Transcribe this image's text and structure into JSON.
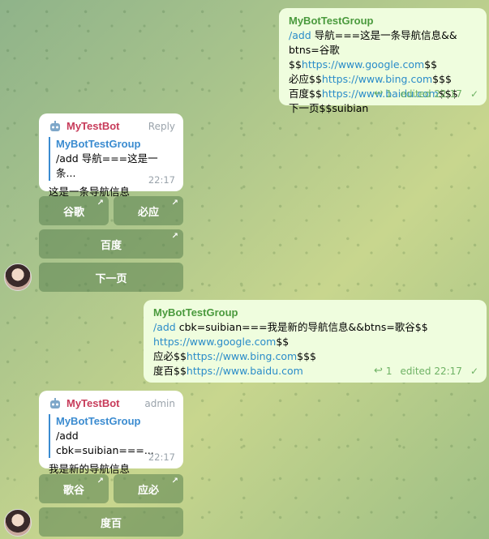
{
  "msg1": {
    "sender": "MyBotTestGroup",
    "lines": [
      [
        {
          "t": "/add",
          "c": "cmd"
        },
        {
          "t": " 导航===这是一条导航信息&&"
        }
      ],
      [
        {
          "t": "btns=谷歌$$"
        },
        {
          "t": "https://www.google.com",
          "c": "link"
        },
        {
          "t": "$$"
        }
      ],
      [
        {
          "t": "必应$$"
        },
        {
          "t": "https://www.bing.com",
          "c": "link"
        },
        {
          "t": "$$$"
        }
      ],
      [
        {
          "t": "百度$$"
        },
        {
          "t": "https://www.baidu.com",
          "c": "link"
        },
        {
          "t": "$$$"
        }
      ],
      [
        {
          "t": "下一页$$suibian"
        }
      ]
    ],
    "replies": "1",
    "edited": "edited 22:17"
  },
  "bot1": {
    "name": "MyTestBot",
    "right": "Reply",
    "quote_name": "MyBotTestGroup",
    "quote_text": "/add 导航===这是一条...",
    "text": "这是一条导航信息",
    "time": "22:17",
    "buttons": [
      "谷歌",
      "必应",
      "百度",
      "下一页"
    ]
  },
  "msg2": {
    "sender": "MyBotTestGroup",
    "lines": [
      [
        {
          "t": "/add",
          "c": "cmd"
        },
        {
          "t": " cbk=suibian===我是新的导航信息&&btns=歌谷$$"
        }
      ],
      [
        {
          "t": "https://www.google.com",
          "c": "link"
        },
        {
          "t": "$$"
        }
      ],
      [
        {
          "t": "应必$$"
        },
        {
          "t": "https://www.bing.com",
          "c": "link"
        },
        {
          "t": "$$$"
        }
      ],
      [
        {
          "t": "度百$$"
        },
        {
          "t": "https://www.baidu.com",
          "c": "link"
        }
      ]
    ],
    "replies": "1",
    "edited": "edited 22:17"
  },
  "bot2": {
    "name": "MyTestBot",
    "right": "admin",
    "quote_name": "MyBotTestGroup",
    "quote_text": "/add cbk=suibian===...",
    "text": "我是新的导航信息",
    "time": "22:17",
    "buttons": [
      "歌谷",
      "应必",
      "度百"
    ]
  },
  "icons": {
    "reply": "reply-arrow-icon",
    "check": "check-icon",
    "link_arrow": "external-link-arrow-icon",
    "bot": "robot-icon"
  },
  "colors": {
    "out_bubble": "#effdde",
    "in_bubble": "#ffffff",
    "sender": "#4a9a3d",
    "bot_name": "#c73b5a",
    "link": "#2a8cc9"
  }
}
